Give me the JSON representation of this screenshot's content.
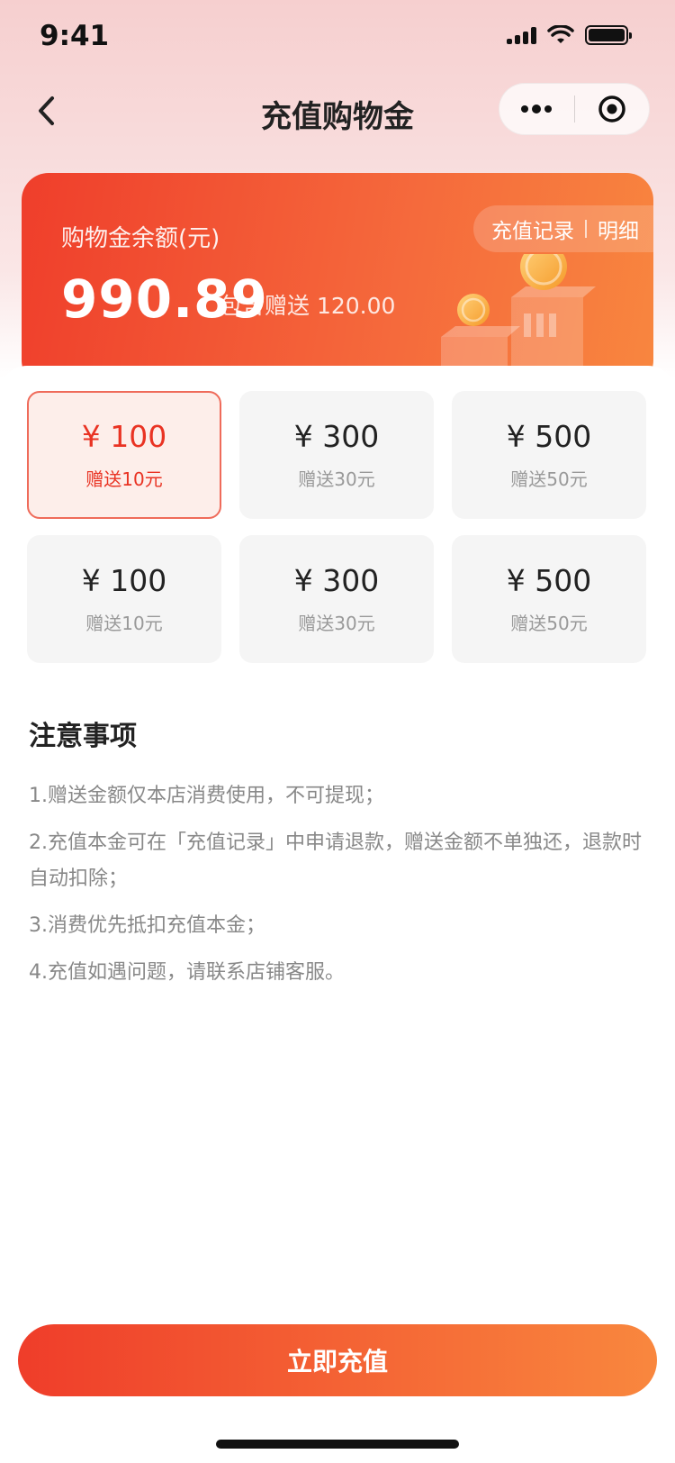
{
  "status_bar": {
    "time": "9:41"
  },
  "nav": {
    "title": "充值购物金"
  },
  "balance": {
    "label": "购物金余额(元)",
    "amount": "990.89",
    "bonus_text": "包含赠送 120.00",
    "record_link": "充值记录",
    "detail_link": "明细"
  },
  "options": [
    {
      "price": "¥ 100",
      "gift": "赠送10元",
      "selected": true
    },
    {
      "price": "¥ 300",
      "gift": "赠送30元",
      "selected": false
    },
    {
      "price": "¥ 500",
      "gift": "赠送50元",
      "selected": false
    },
    {
      "price": "¥ 100",
      "gift": "赠送10元",
      "selected": false
    },
    {
      "price": "¥ 300",
      "gift": "赠送30元",
      "selected": false
    },
    {
      "price": "¥ 500",
      "gift": "赠送50元",
      "selected": false
    }
  ],
  "notice": {
    "title": "注意事项",
    "items": [
      "1.赠送金额仅本店消费使用，不可提现；",
      "2.充值本金可在「充值记录」中申请退款，赠送金额不单独还，退款时自动扣除；",
      "3.消费优先抵扣充值本金；",
      "4.充值如遇问题，请联系店铺客服。"
    ]
  },
  "cta": {
    "label": "立即充值"
  },
  "colors": {
    "accent": "#e93323",
    "gradient_start": "#ef3d2a",
    "gradient_end": "#f9873e"
  }
}
